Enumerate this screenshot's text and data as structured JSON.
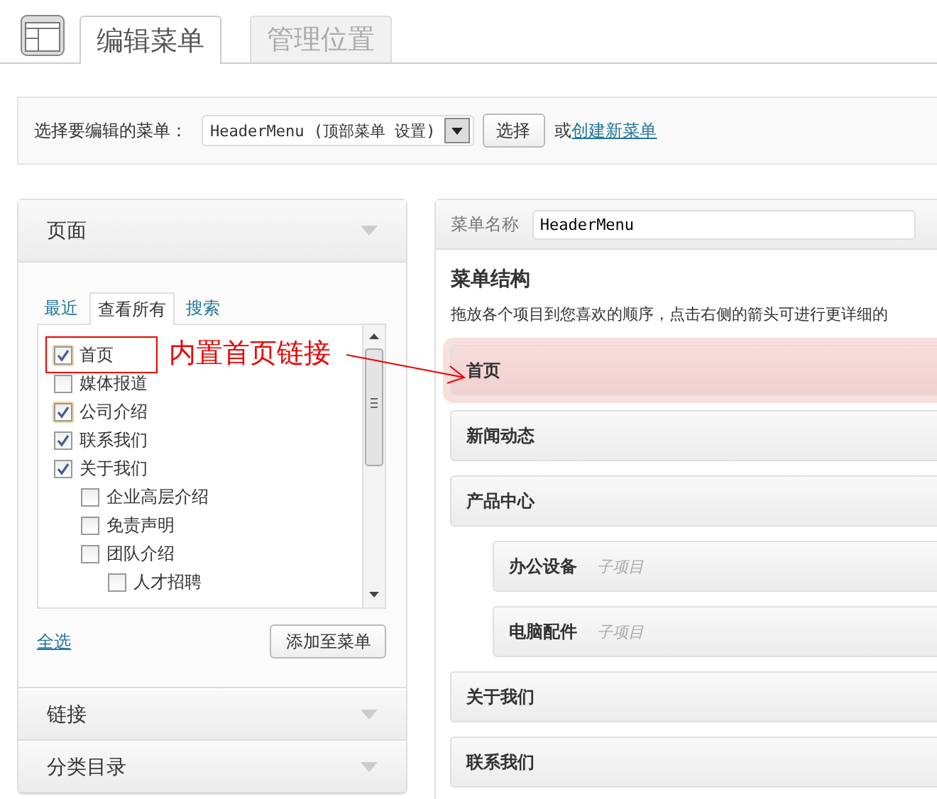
{
  "header_tabs": [
    {
      "label": "编辑菜单",
      "selected": true
    },
    {
      "label": "管理位置",
      "selected": false
    }
  ],
  "menu_select": {
    "label": "选择要编辑的菜单：",
    "value": "HeaderMenu (顶部菜单 设置)",
    "button": "选择",
    "or_text": "或",
    "create_link": "创建新菜单"
  },
  "pages_panel": {
    "title": "页面",
    "tabs": [
      {
        "label": "最近",
        "selected": false
      },
      {
        "label": "查看所有",
        "selected": true
      },
      {
        "label": "搜索",
        "selected": false
      }
    ],
    "items": [
      {
        "label": "首页",
        "checked": true,
        "highlighted": true,
        "annotated": true
      },
      {
        "label": "媒体报道",
        "checked": false,
        "highlighted": false
      },
      {
        "label": "公司介绍",
        "checked": true,
        "highlighted": true
      },
      {
        "label": "联系我们",
        "checked": true,
        "highlighted": false
      },
      {
        "label": "关于我们",
        "checked": true,
        "highlighted": false,
        "children": [
          {
            "label": "企业高层介绍",
            "checked": false,
            "highlighted": false
          },
          {
            "label": "免责声明",
            "checked": false,
            "highlighted": false
          },
          {
            "label": "团队介绍",
            "checked": false,
            "highlighted": false,
            "children": [
              {
                "label": "人才招聘",
                "checked": false,
                "highlighted": false
              }
            ]
          }
        ]
      }
    ],
    "select_all": "全选",
    "add_button": "添加至菜单"
  },
  "collapsed_sections": [
    {
      "title": "链接"
    },
    {
      "title": "分类目录"
    }
  ],
  "menu_editor": {
    "name_label": "菜单名称",
    "name_value": "HeaderMenu",
    "structure_title": "菜单结构",
    "description": "拖放各个项目到您喜欢的顺序，点击右侧的箭头可进行更详细的",
    "items": [
      {
        "label": "首页",
        "highlighted": true
      },
      {
        "label": "新闻动态",
        "highlighted": false
      },
      {
        "label": "产品中心",
        "highlighted": false,
        "children": [
          {
            "label": "办公设备",
            "sublabel": "子项目",
            "highlighted": false
          },
          {
            "label": "电脑配件",
            "sublabel": "子项目",
            "highlighted": false
          }
        ]
      },
      {
        "label": "关于我们",
        "highlighted": false
      },
      {
        "label": "联系我们",
        "highlighted": false
      }
    ]
  },
  "annotation": {
    "label": "内置首页链接"
  }
}
